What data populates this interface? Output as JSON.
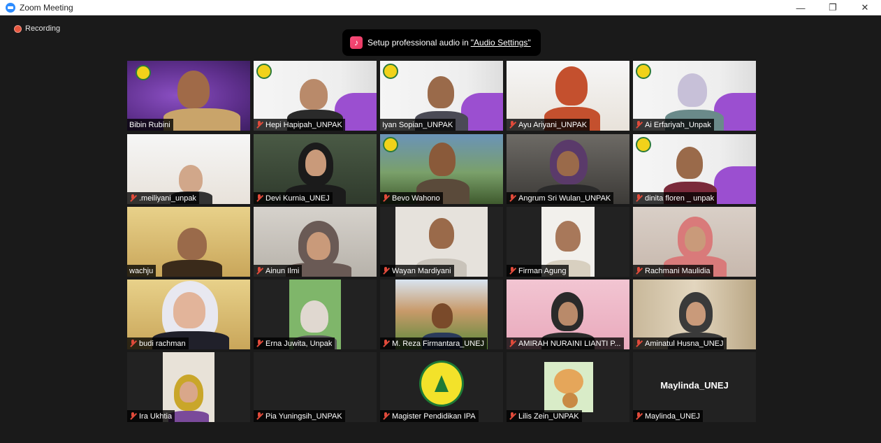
{
  "window": {
    "title": "Zoom Meeting",
    "minimize_glyph": "—",
    "restore_glyph": "❐",
    "close_glyph": "✕"
  },
  "recording": {
    "label": "Recording",
    "color": "#e8573f"
  },
  "audio_banner": {
    "text": "Setup professional audio in ",
    "link": "\"Audio Settings\""
  },
  "participants": [
    {
      "name": "Bibin Rubini",
      "muted": false
    },
    {
      "name": "Hepi Hapipah_UNPAK",
      "muted": true
    },
    {
      "name": "Iyan Sopian_UNPAK",
      "muted": false,
      "speaking": true
    },
    {
      "name": "Ayu Ariyani_UNPAK",
      "muted": true
    },
    {
      "name": "Ai Erfariyah_Unpak",
      "muted": true
    },
    {
      "name": ".meiliyani_unpak",
      "muted": true
    },
    {
      "name": "Devi Kurnia_UNEJ",
      "muted": true
    },
    {
      "name": "Bevo Wahono",
      "muted": true
    },
    {
      "name": "Angrum Sri Wulan_UNPAK",
      "muted": true
    },
    {
      "name": "dinita floren _ unpak",
      "muted": true
    },
    {
      "name": "wachju",
      "muted": false
    },
    {
      "name": "Ainun Ilmi",
      "muted": true
    },
    {
      "name": "Wayan Mardiyani",
      "muted": true
    },
    {
      "name": "Firman Agung",
      "muted": true
    },
    {
      "name": "Rachmani Maulidia",
      "muted": true
    },
    {
      "name": "budi rachman",
      "muted": true
    },
    {
      "name": "Erna Juwita, Unpak",
      "muted": true
    },
    {
      "name": "M. Reza Firmantara_UNEJ",
      "muted": true
    },
    {
      "name": "AMIRAH NURAINI LIANTI P...",
      "muted": true
    },
    {
      "name": "Aminatul Husna_UNEJ",
      "muted": true
    },
    {
      "name": "Ira Ukhtia",
      "muted": true
    },
    {
      "name": "Pia Yuningsih_UNPAK",
      "muted": true
    },
    {
      "name": "Magister Pendidikan IPA",
      "muted": true
    },
    {
      "name": "Lilis Zein_UNPAK",
      "muted": true
    },
    {
      "name": "Maylinda_UNEJ",
      "muted": true,
      "video_off_label": "Maylinda_UNEJ"
    }
  ],
  "colors": {
    "speaking_outline": "#cde86b",
    "mute_icon": "#e04a3a",
    "zoom_blue": "#2d8cff"
  }
}
